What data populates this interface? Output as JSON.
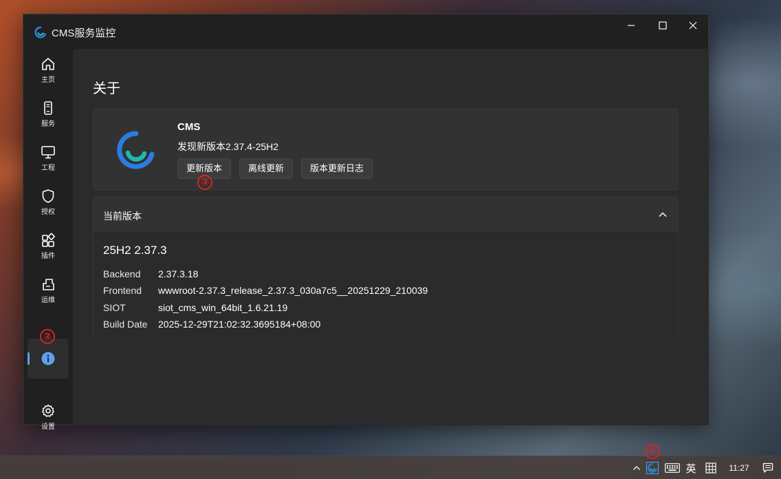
{
  "window": {
    "title": "CMS服务监控"
  },
  "sidebar": {
    "items": [
      {
        "label": "主页",
        "icon": "home-icon"
      },
      {
        "label": "服务",
        "icon": "phone-icon"
      },
      {
        "label": "工程",
        "icon": "monitor-icon"
      },
      {
        "label": "授权",
        "icon": "shield-icon"
      },
      {
        "label": "插件",
        "icon": "apps-icon"
      },
      {
        "label": "运维",
        "icon": "tools-icon"
      },
      {
        "label": "",
        "icon": "info-icon",
        "active": true
      },
      {
        "label": "设置",
        "icon": "gear-icon"
      }
    ]
  },
  "main": {
    "page_title": "关于",
    "update_card": {
      "product_name": "CMS",
      "new_version_text": "发现新版本2.37.4-25H2",
      "buttons": [
        "更新版本",
        "离线更新",
        "版本更新日志"
      ]
    },
    "version_card": {
      "header": "当前版本",
      "current_version": "25H2 2.37.3",
      "details": [
        {
          "key": "Backend",
          "value": "2.37.3.18"
        },
        {
          "key": "Frontend",
          "value": "wwwroot-2.37.3_release_2.37.3_030a7c5__20251229_210039"
        },
        {
          "key": "SIOT",
          "value": "siot_cms_win_64bit_1.6.21.19"
        },
        {
          "key": "Build Date",
          "value": "2025-12-29T21:02:32.3695184+08:00"
        }
      ]
    }
  },
  "annotations": {
    "marker_1": "①",
    "marker_2": "②",
    "marker_3": "③"
  },
  "taskbar": {
    "input_method": "英",
    "time": "11:27"
  },
  "colors": {
    "accent": "#60a0e8",
    "marker": "#e02020",
    "logo_blue": "#2a7de1",
    "logo_teal": "#1fb9a8"
  }
}
